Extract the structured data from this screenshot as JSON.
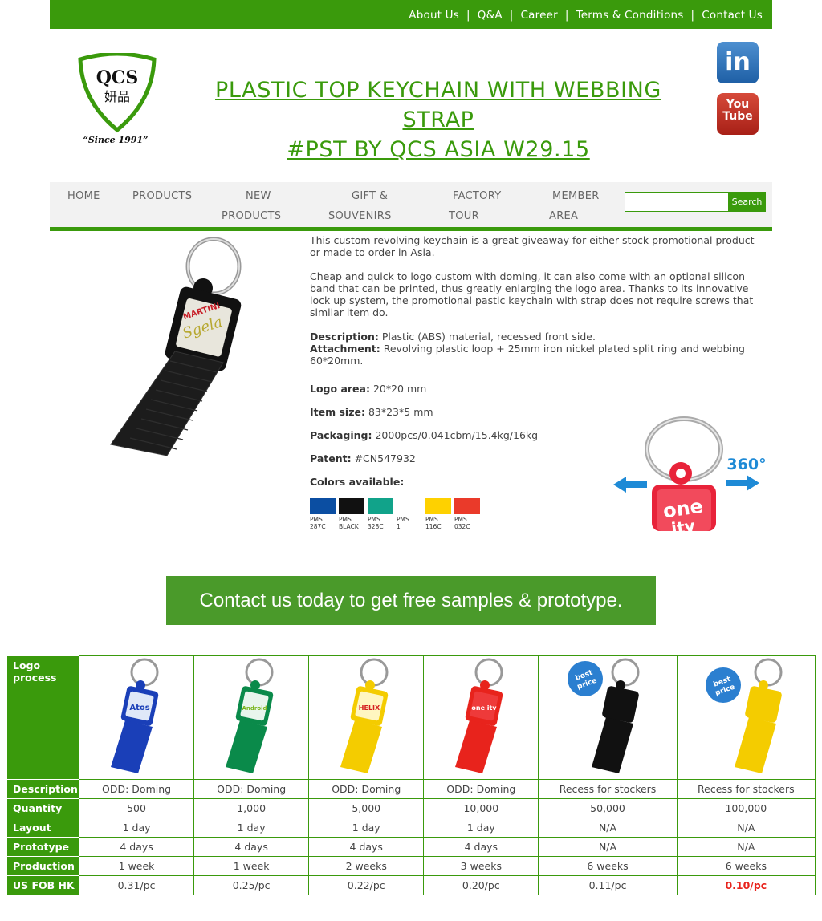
{
  "topnav": {
    "links": [
      "About Us",
      "Q&A",
      "Career",
      "Terms & Conditions",
      "Contact Us"
    ]
  },
  "logo": {
    "name": "QCS",
    "chinese": "妍品",
    "since": "“Since 1991”"
  },
  "title": {
    "line1": "PLASTIC TOP KEYCHAIN WITH WEBBING STRAP",
    "line2": "#PST BY QCS ASIA W29.15"
  },
  "social": {
    "linkedin": "in",
    "youtube_1": "You",
    "youtube_2": "Tube"
  },
  "mainnav": {
    "home": "HOME",
    "products": "PRODUCTS",
    "new_1": "NEW",
    "new_2": "PRODUCTS",
    "gift_1": "GIFT &",
    "gift_2": "SOUVENIRS",
    "factory_1": "FACTORY",
    "factory_2": "TOUR",
    "member_1": "MEMBER",
    "member_2": "AREA",
    "search_button": "Search"
  },
  "product_image": {
    "brand_1": "MARTINI",
    "brand_2": "Sgela"
  },
  "description": {
    "p1": "This custom revolving keychain is a great giveaway for either stock promotional product or made to order in Asia.",
    "p2": "Cheap and quick to logo custom with doming, it can also come with an optional silicon band that can be printed, thus greatly enlarging the logo area. Thanks to its innovative lock up system, the promotional pastic keychain with strap does not require screws that similar item do.",
    "desc_label": "Description:",
    "desc_value": "Plastic (ABS) material, recessed front side.",
    "attach_label": "Attachment:",
    "attach_value": "Revolving plastic loop + 25mm iron nickel plated split ring and webbing 60*20mm."
  },
  "specs": {
    "logo_area_label": "Logo area:",
    "logo_area": "20*20 mm",
    "item_size_label": "Item size:",
    "item_size": "83*23*5 mm",
    "packaging_label": "Packaging:",
    "packaging": "2000pcs/0.041cbm/15.4kg/16kg",
    "patent_label": "Patent:",
    "patent": "#CN547932",
    "colors_label": "Colors available:"
  },
  "swatches": [
    {
      "l1": "PMS",
      "l2": "287C",
      "color": "#0b4ea2"
    },
    {
      "l1": "PMS",
      "l2": "BLACK",
      "color": "#111111"
    },
    {
      "l1": "PMS",
      "l2": "328C",
      "color": "#11a38a"
    },
    {
      "l1": "PMS",
      "l2": "1",
      "color": "#ffffff"
    },
    {
      "l1": "PMS",
      "l2": "116C",
      "color": "#fed100"
    },
    {
      "l1": "PMS",
      "l2": "032C",
      "color": "#ea3a2a"
    }
  ],
  "rotation": {
    "label": "360°",
    "text_1": "one",
    "text_2": "itv"
  },
  "cta": "Contact us today to get free samples & prototype.",
  "table": {
    "headers": [
      "Logo\nprocess",
      "Description",
      "Quantity",
      "Layout",
      "Prototype",
      "Production",
      "US FOB HK"
    ],
    "badge_1": "best",
    "badge_2": "price",
    "columns": [
      {
        "logo": "Atos",
        "color": "#1a3fb8",
        "description": "ODD: Doming",
        "quantity": "500",
        "layout": "1 day",
        "prototype": "4 days",
        "production": "1 week",
        "price": "0.31/pc"
      },
      {
        "logo": "Android",
        "color": "#0a8a4a",
        "description": "ODD: Doming",
        "quantity": "1,000",
        "layout": "1 day",
        "prototype": "4 days",
        "production": "1 week",
        "price": "0.25/pc"
      },
      {
        "logo": "HELIX",
        "color": "#f4cc00",
        "description": "ODD: Doming",
        "quantity": "5,000",
        "layout": "1 day",
        "prototype": "4 days",
        "production": "2 weeks",
        "price": "0.22/pc"
      },
      {
        "logo": "one itv",
        "color": "#e8231c",
        "description": "ODD: Doming",
        "quantity": "10,000",
        "layout": "1 day",
        "prototype": "4 days",
        "production": "3 weeks",
        "price": "0.20/pc"
      },
      {
        "logo": "",
        "color": "#111111",
        "description": "Recess for stockers",
        "quantity": "50,000",
        "layout": "N/A",
        "prototype": "N/A",
        "production": "6 weeks",
        "price": "0.11/pc"
      },
      {
        "logo": "",
        "color": "#f4cc00",
        "description": "Recess for stockers",
        "quantity": "100,000",
        "layout": "N/A",
        "prototype": "N/A",
        "production": "6 weeks",
        "price": "0.10/pc"
      }
    ]
  }
}
